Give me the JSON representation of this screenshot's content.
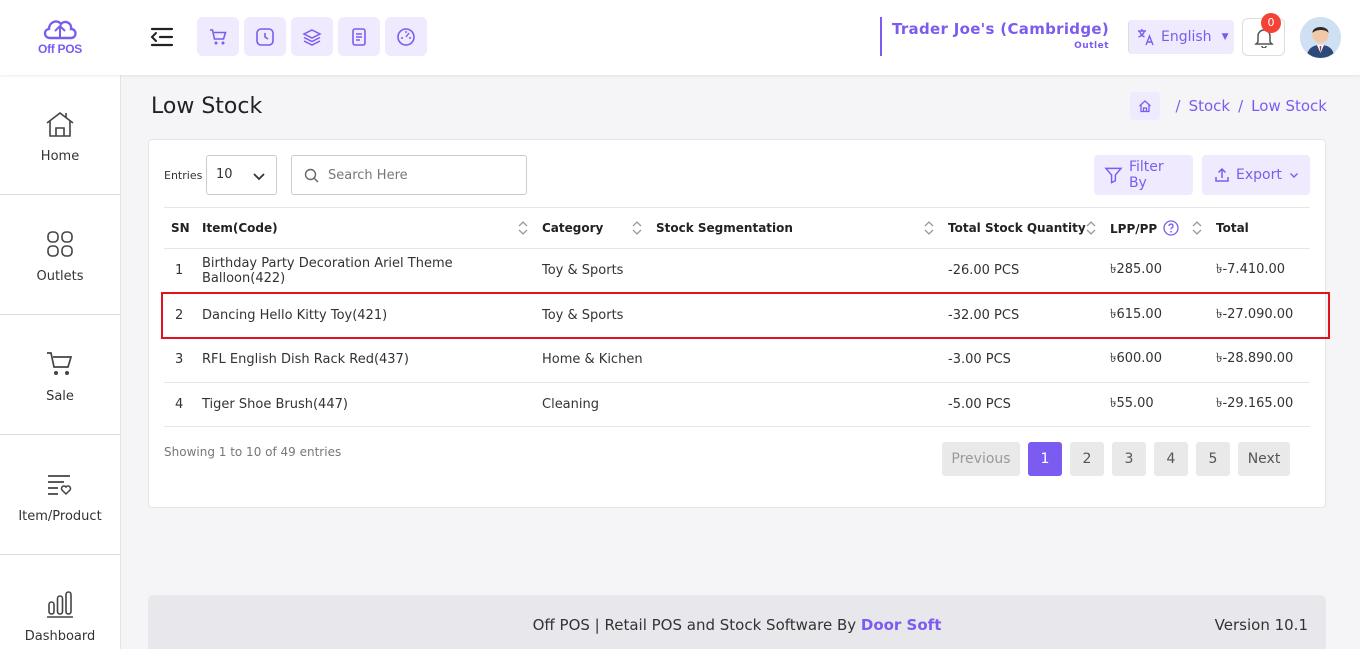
{
  "header": {
    "logo_text": "Off POS",
    "outlet_name": "Trader Joe's (Cambridge)",
    "outlet_label": "Outlet",
    "language": "English",
    "notification_count": "0",
    "quick_icons": [
      "cart-icon",
      "clock-icon",
      "layers-icon",
      "receipt-icon",
      "dashboard-gauge-icon"
    ]
  },
  "sidebar": {
    "items": [
      {
        "label": "Home",
        "icon": "home-icon"
      },
      {
        "label": "Outlets",
        "icon": "grid-icon"
      },
      {
        "label": "Sale",
        "icon": "cart-icon"
      },
      {
        "label": "Item/Product",
        "icon": "list-heart-icon"
      },
      {
        "label": "Dashboard",
        "icon": "bar-chart-icon"
      }
    ]
  },
  "page": {
    "title": "Low Stock",
    "breadcrumb": [
      "Stock",
      "Low Stock"
    ]
  },
  "controls": {
    "entries_label": "Entries",
    "entries_value": "10",
    "search_placeholder": "Search Here",
    "filter_label": "Filter By",
    "export_label": "Export"
  },
  "table": {
    "columns": [
      "SN",
      "Item(Code)",
      "Category",
      "Stock Segmentation",
      "Total Stock Quantity",
      "LPP/PP",
      "Total"
    ],
    "rows": [
      {
        "sn": "1",
        "item": "Birthday Party Decoration Ariel Theme Balloon(422)",
        "category": "Toy & Sports",
        "segmentation": "",
        "quantity": "-26.00 PCS",
        "lpp": "৳285.00",
        "total": "৳-7.410.00"
      },
      {
        "sn": "2",
        "item": "Dancing Hello Kitty Toy(421)",
        "category": "Toy & Sports",
        "segmentation": "",
        "quantity": "-32.00 PCS",
        "lpp": "৳615.00",
        "total": "৳-27.090.00"
      },
      {
        "sn": "3",
        "item": "RFL English Dish Rack Red(437)",
        "category": "Home & Kichen",
        "segmentation": "",
        "quantity": "-3.00 PCS",
        "lpp": "৳600.00",
        "total": "৳-28.890.00"
      },
      {
        "sn": "4",
        "item": "Tiger Shoe Brush(447)",
        "category": "Cleaning",
        "segmentation": "",
        "quantity": "-5.00 PCS",
        "lpp": "৳55.00",
        "total": "৳-29.165.00"
      }
    ]
  },
  "pagination": {
    "showing": "Showing 1 to 10 of 49 entries",
    "previous": "Previous",
    "pages": [
      "1",
      "2",
      "3",
      "4",
      "5"
    ],
    "next": "Next"
  },
  "footer": {
    "text": "Off POS | Retail POS and Stock Software By ",
    "brand": "Door Soft",
    "version": "Version 10.1"
  },
  "colors": {
    "accent": "#7c5cf0",
    "accent_light": "#efeafd",
    "highlight": "#e0131d",
    "badge": "#f44336"
  }
}
